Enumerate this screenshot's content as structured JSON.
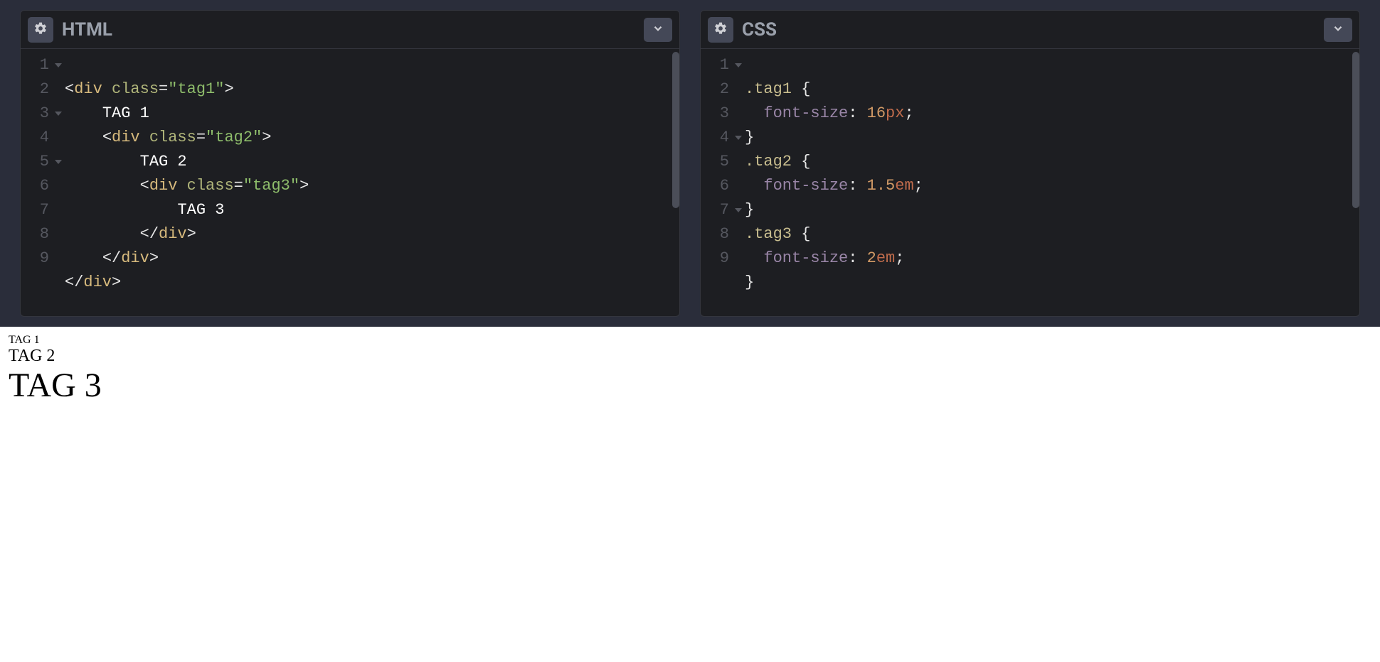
{
  "panels": {
    "html": {
      "title": "HTML"
    },
    "css": {
      "title": "CSS"
    }
  },
  "html_code": {
    "line_numbers": [
      "1",
      "2",
      "3",
      "4",
      "5",
      "6",
      "7",
      "8",
      "9"
    ],
    "fold_lines": [
      1,
      3,
      5
    ],
    "l1": {
      "open": "<",
      "tag": "div",
      "attr": "class",
      "eq": "=",
      "q1": "\"",
      "val": "tag1",
      "q2": "\"",
      "close": ">"
    },
    "l2": {
      "text": "TAG 1"
    },
    "l3": {
      "open": "<",
      "tag": "div",
      "attr": "class",
      "eq": "=",
      "q1": "\"",
      "val": "tag2",
      "q2": "\"",
      "close": ">"
    },
    "l4": {
      "text": "TAG 2"
    },
    "l5": {
      "open": "<",
      "tag": "div",
      "attr": "class",
      "eq": "=",
      "q1": "\"",
      "val": "tag3",
      "q2": "\"",
      "close": ">"
    },
    "l6": {
      "text": "TAG 3"
    },
    "l7": {
      "open": "</",
      "tag": "div",
      "close": ">"
    },
    "l8": {
      "open": "</",
      "tag": "div",
      "close": ">"
    },
    "l9": {
      "open": "</",
      "tag": "div",
      "close": ">"
    }
  },
  "css_code": {
    "line_numbers": [
      "1",
      "2",
      "3",
      "4",
      "5",
      "6",
      "7",
      "8",
      "9"
    ],
    "fold_lines": [
      1,
      4,
      7
    ],
    "l1": {
      "sel": ".tag1",
      "brace": "{"
    },
    "l2": {
      "prop": "font-size",
      "colon": ":",
      "num": "16",
      "unit": "px",
      "semi": ";"
    },
    "l3": {
      "brace": "}"
    },
    "l4": {
      "sel": ".tag2",
      "brace": "{"
    },
    "l5": {
      "prop": "font-size",
      "colon": ":",
      "num": "1.5",
      "unit": "em",
      "semi": ";"
    },
    "l6": {
      "brace": "}"
    },
    "l7": {
      "sel": ".tag3",
      "brace": "{"
    },
    "l8": {
      "prop": "font-size",
      "colon": ":",
      "num": "2",
      "unit": "em",
      "semi": ";"
    },
    "l9": {
      "brace": "}"
    }
  },
  "output": {
    "tag1": "TAG 1",
    "tag2": "TAG 2",
    "tag3": "TAG 3"
  }
}
